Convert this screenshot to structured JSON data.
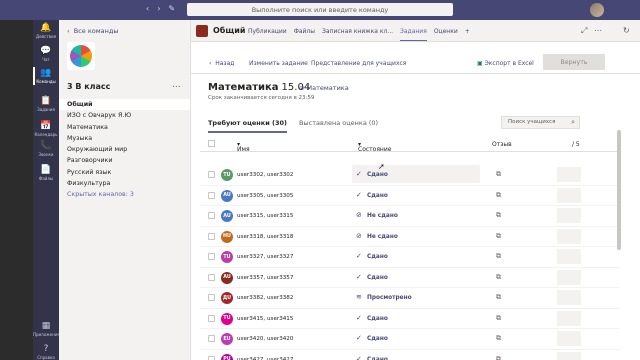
{
  "topbar": {
    "search_placeholder": "Выполните поиск или введите команду"
  },
  "rail": [
    {
      "label": "Действия",
      "icon": "bell-icon",
      "glyph": "🔔"
    },
    {
      "label": "Чат",
      "icon": "chat-icon",
      "glyph": "💬"
    },
    {
      "label": "Команды",
      "icon": "teams-icon",
      "glyph": "👥"
    },
    {
      "label": "Задания",
      "icon": "assignments-icon",
      "glyph": "📋"
    },
    {
      "label": "Календарь",
      "icon": "calendar-icon",
      "glyph": "📅"
    },
    {
      "label": "Звонки",
      "icon": "phone-icon",
      "glyph": "📞"
    },
    {
      "label": "Файлы",
      "icon": "files-icon",
      "glyph": "📄"
    },
    {
      "label": "Приложения",
      "icon": "apps-icon",
      "glyph": "▦"
    },
    {
      "label": "Справка",
      "icon": "help-icon",
      "glyph": "?"
    }
  ],
  "left": {
    "back_label": "Все команды",
    "team_name": "3 В класс",
    "more": "...",
    "channels": [
      "Общий",
      "ИЗО с Овчарук Я.Ю",
      "Математика",
      "Музыка",
      "Окружающий мир",
      "Разговорчики",
      "Русский язык",
      "Физкультура",
      "Скрытых каналов: 3"
    ]
  },
  "tabbar": {
    "title": "Общий",
    "tabs": [
      "Публикации",
      "Файлы",
      "Записная книжка кл...",
      "Задания",
      "Оценки",
      "+"
    ]
  },
  "toolbar": {
    "back": "Назад",
    "edit": "Изменить задание",
    "student_view": "Представление для учащихся",
    "export": "Экспорт в Excel",
    "return": "Вернуть"
  },
  "assignment": {
    "title": "Математика",
    "date": "15.04",
    "subject": "Математика",
    "due": "Срок заканчивается сегодня в 23:59"
  },
  "subtabs": {
    "need_grading": "Требуют оценки (30)",
    "graded": "Выставлена оценка (0)"
  },
  "search": {
    "placeholder": "Поиск учащихся"
  },
  "table": {
    "col_name": "Имя",
    "col_status": "Состояние",
    "col_feedback": "Отзыв",
    "col_points": "/ 5",
    "rows": [
      {
        "initials": "TU",
        "color": "#5b9a68",
        "name": "user3302, user3302",
        "status": "Сдано",
        "status_icon": "check-icon",
        "glyph": "✓"
      },
      {
        "initials": "AU",
        "color": "#4a78c2",
        "name": "user3305, user3305",
        "status": "Сдано",
        "status_icon": "check-icon",
        "glyph": "✓"
      },
      {
        "initials": "AU",
        "color": "#4a78c2",
        "name": "user3315, user3315",
        "status": "Не сдано",
        "status_icon": "not-submitted-icon",
        "glyph": "⊘"
      },
      {
        "initials": "HU",
        "color": "#c16a1f",
        "name": "user3318, user3318",
        "status": "Не сдано",
        "status_icon": "not-submitted-icon",
        "glyph": "⊘"
      },
      {
        "initials": "TU",
        "color": "#b83ea6",
        "name": "user3327, user3327",
        "status": "Сдано",
        "status_icon": "check-icon",
        "glyph": "✓"
      },
      {
        "initials": "AU",
        "color": "#8a2b1d",
        "name": "user3357, user3357",
        "status": "Сдано",
        "status_icon": "check-icon",
        "glyph": "✓"
      },
      {
        "initials": "ДU",
        "color": "#a4262c",
        "name": "user3382, user3382",
        "status": "Просмотрено",
        "status_icon": "viewed-icon",
        "glyph": "≋"
      },
      {
        "initials": "TU",
        "color": "#e3008c",
        "name": "user3415, user3415",
        "status": "Сдано",
        "status_icon": "check-icon",
        "glyph": "✓"
      },
      {
        "initials": "EU",
        "color": "#c239b3",
        "name": "user3420, user3420",
        "status": "Сдано",
        "status_icon": "check-icon",
        "glyph": "✓"
      },
      {
        "initials": "PU",
        "color": "#b4009e",
        "name": "user3427, user3427",
        "status": "Сдано",
        "status_icon": "check-icon",
        "glyph": "✓"
      }
    ]
  }
}
